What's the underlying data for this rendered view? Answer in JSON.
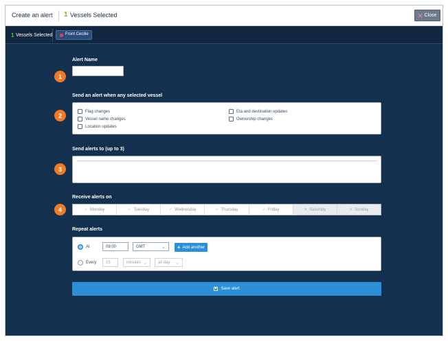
{
  "header": {
    "title": "Create an alert",
    "selected_count": "1",
    "selected_label": "Vessels Selected",
    "close_label": "Close"
  },
  "vessel_bar": {
    "count": "1",
    "label": "Vessels Selected",
    "vessel_chip": "Front Cecilie"
  },
  "steps": [
    "1",
    "2",
    "3",
    "4"
  ],
  "sections": {
    "alert_name": "Alert Name",
    "send_when": "Send an alert when any selected vessel",
    "send_to": "Send alerts to (up to 3)",
    "receive_on": "Receive alerts on",
    "repeat": "Repeat alerts"
  },
  "alert_name_value": "",
  "conditions": [
    {
      "label": "Flag changes",
      "checked": false
    },
    {
      "label": "Vessel name changes",
      "checked": false
    },
    {
      "label": "Location updates",
      "checked": false
    },
    {
      "label": "Eta and destination updates",
      "checked": false
    },
    {
      "label": "Ownership changes",
      "checked": false
    }
  ],
  "days": [
    {
      "label": "Monday",
      "mark": "✓",
      "active": true
    },
    {
      "label": "Tuesday",
      "mark": "✓",
      "active": true
    },
    {
      "label": "Wednesday",
      "mark": "✓",
      "active": true
    },
    {
      "label": "Thursday",
      "mark": "✓",
      "active": true
    },
    {
      "label": "Friday",
      "mark": "✓",
      "active": true
    },
    {
      "label": "Saturday",
      "mark": "✕",
      "active": false
    },
    {
      "label": "Sunday",
      "mark": "✕",
      "active": false
    }
  ],
  "repeat": {
    "at_label": "At",
    "time_value": "09:00",
    "timezone": "GMT",
    "add_another": "Add another",
    "every_label": "Every",
    "every_value": "15",
    "unit": "minutes",
    "period": "all day"
  },
  "save_label": "Save alert",
  "colors": {
    "accent": "#2a8fd6",
    "step_badge": "#f07a25",
    "background": "#14304f",
    "count_green": "#6cbf2f",
    "vessel_dot": "#e2416a"
  }
}
